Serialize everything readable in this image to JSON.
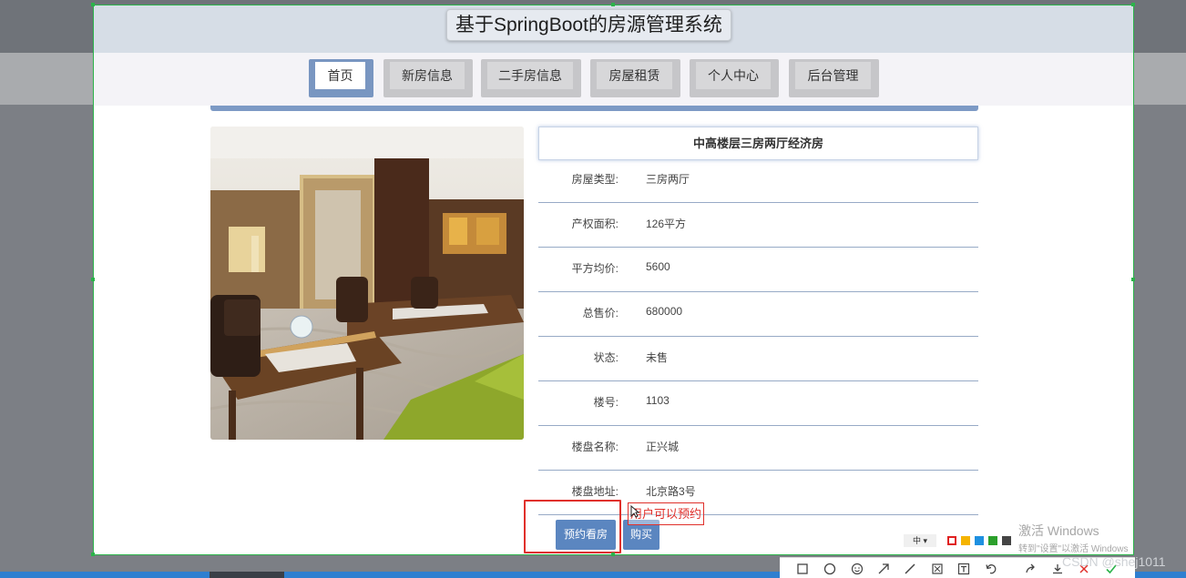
{
  "site_title": "基于SpringBoot的房源管理系统",
  "nav": {
    "tabs": [
      {
        "label": "首页",
        "active": true
      },
      {
        "label": "新房信息",
        "active": false
      },
      {
        "label": "二手房信息",
        "active": false
      },
      {
        "label": "房屋租赁",
        "active": false
      },
      {
        "label": "个人中心",
        "active": false
      },
      {
        "label": "后台管理",
        "active": false
      }
    ]
  },
  "property": {
    "title": "中高楼层三房两厅经济房",
    "details": [
      {
        "label": "房屋类型:",
        "value": "三房两厅"
      },
      {
        "label": "产权面积:",
        "value": "126平方"
      },
      {
        "label": "平方均价:",
        "value": "5600"
      },
      {
        "label": "总售价:",
        "value": "680000"
      },
      {
        "label": "状态:",
        "value": "未售"
      },
      {
        "label": "楼号:",
        "value": "1103"
      },
      {
        "label": "楼盘名称:",
        "value": "正兴城"
      },
      {
        "label": "楼盘地址:",
        "value": "北京路3号"
      }
    ],
    "image_alt": "dining-room-photo"
  },
  "actions": {
    "reserve_label": "预约看房",
    "buy_label": "购买"
  },
  "annotation": {
    "note": "用户可以预约"
  },
  "watermark": {
    "line1": "激活 Windows",
    "line2": "转到\"设置\"以激活 Windows",
    "csdn": "CSDN @shej1011"
  },
  "snip_toolbar": {
    "size_label": "中 ▾",
    "colors": [
      "#e02020",
      "#f5b400",
      "#1e90e0",
      "#2ca02c",
      "#444444"
    ],
    "tools": [
      "rectangle-icon",
      "ellipse-icon",
      "emoji-icon",
      "arrow-icon",
      "line-icon",
      "mosaic-icon",
      "text-icon",
      "undo-icon",
      "share-icon",
      "download-icon",
      "cancel-icon",
      "confirm-icon"
    ]
  },
  "colors": {
    "accent": "#5b86c0",
    "annotation": "#e0302b",
    "selection": "#2bb34a"
  }
}
